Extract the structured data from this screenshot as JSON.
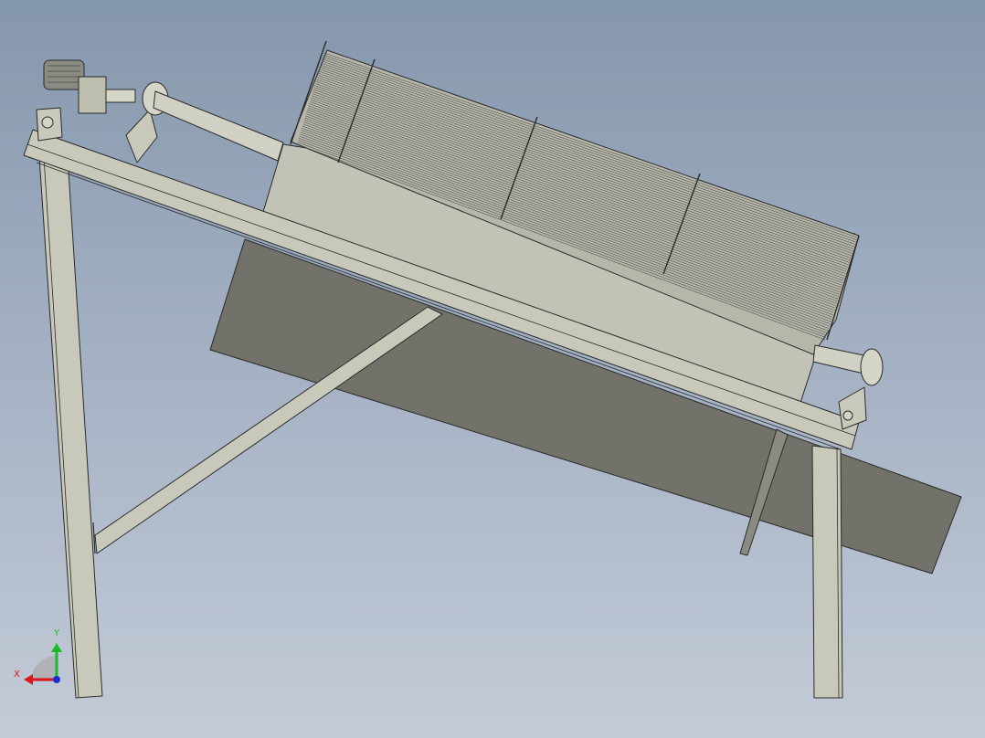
{
  "triad": {
    "x_label": "X",
    "y_label": "Y",
    "x_color": "#e0141c",
    "y_color": "#1db82a",
    "z_color": "#1a2fd0"
  },
  "colors": {
    "frame": "#c9c9bb",
    "drum_body": "#c2c2b6",
    "trough_shadow": "#72726a",
    "line": "#2a2a2a"
  },
  "components": [
    "motor",
    "gearbox",
    "coupling",
    "bearing",
    "shaft",
    "drum-screen",
    "trough",
    "frame",
    "brace"
  ]
}
